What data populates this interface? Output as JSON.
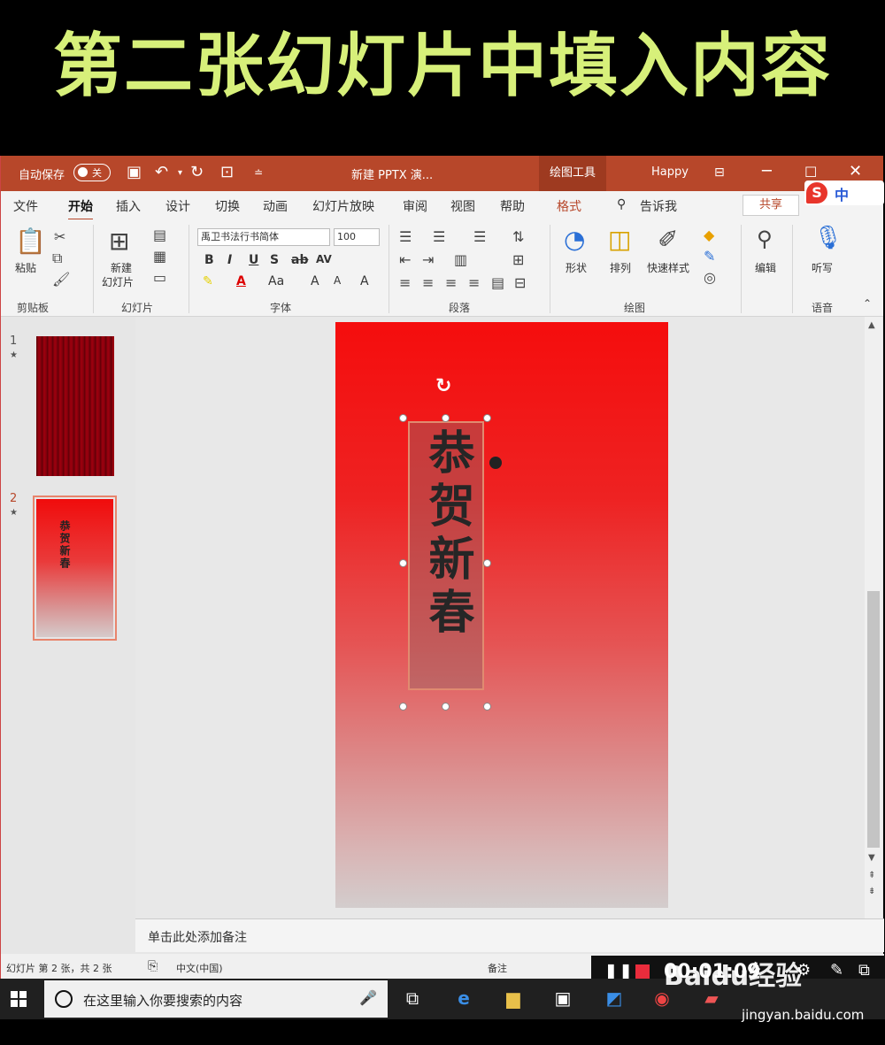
{
  "caption": "第二张幻灯片中填入内容",
  "title_bar": {
    "autosave_label": "自动保存",
    "autosave_state": "关",
    "document_title": "新建 PPTX 演...",
    "context_tools": "绘图工具",
    "user": "Happy"
  },
  "tabs": [
    "文件",
    "开始",
    "插入",
    "设计",
    "切换",
    "动画",
    "幻灯片放映",
    "审阅",
    "视图",
    "帮助",
    "格式"
  ],
  "tell_me": "告诉我",
  "share": "共享",
  "ime": {
    "logo": "S",
    "mode": "中"
  },
  "ribbon": {
    "paste": "粘贴",
    "new_slide_line1": "新建",
    "new_slide_line2": "幻灯片",
    "font_name": "禹卫书法行书简体",
    "font_size": "100",
    "shape": "形状",
    "arrange": "排列",
    "quick_styles": "快速样式",
    "edit": "编辑",
    "dictate": "听写",
    "groups": [
      "剪贴板",
      "幻灯片",
      "字体",
      "段落",
      "绘图",
      "语音"
    ]
  },
  "thumbnails": [
    {
      "number": "1",
      "star": "★"
    },
    {
      "number": "2",
      "star": "★",
      "text": "恭贺新春"
    }
  ],
  "slide": {
    "text": "恭贺新春"
  },
  "notes_placeholder": "单击此处添加备注",
  "status_bar": {
    "slide_count": "幻灯片 第 2 张，共 2 张",
    "language": "中文(中国)",
    "notes_btn": "备注"
  },
  "recorder": {
    "time": "00:01:09"
  },
  "taskbar": {
    "search_placeholder": "在这里输入你要搜索的内容"
  },
  "watermark": {
    "brand": "Baidu经验",
    "url": "jingyan.baidu.com"
  },
  "colors": {
    "accent": "#b7472a",
    "caption": "#d7f07a",
    "slide_top": "#f50d0d",
    "slide_bottom": "#d3cdcd"
  }
}
